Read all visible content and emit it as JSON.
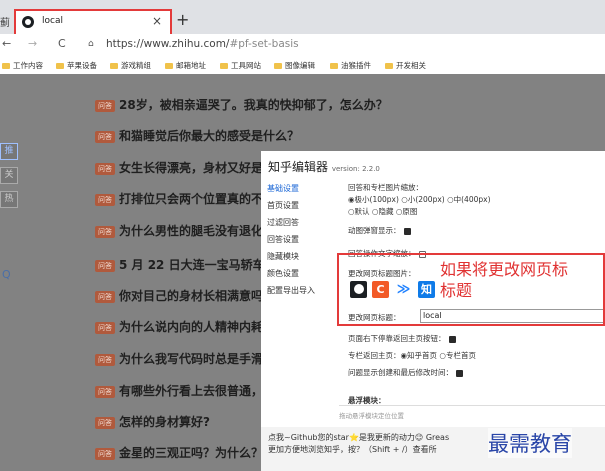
{
  "browser": {
    "left_cut_text": "蓟",
    "tab_title": "local",
    "tab_close": "×",
    "new_tab": "+",
    "back": "←",
    "forward": "→",
    "reload": "C",
    "url_host": "https://www.zhihu.com/",
    "url_rest": "#pf-set-basis",
    "bookmarks": [
      "工作内容",
      "苹果设备",
      "游戏精组",
      "邮箱地址",
      "工具网站",
      "图像编辑",
      "油猴插件",
      "开发相关"
    ]
  },
  "left_sidebar": {
    "tabs": [
      "推",
      "关",
      "热"
    ],
    "search": "Q"
  },
  "questions": {
    "badge": "问答",
    "items": [
      "28岁，被相亲逼哭了。我真的快抑郁了，怎么办？",
      "和猫睡觉后你最大的感受是什么？",
      "女生长得漂亮，身材又好是怎",
      "打排位只会两个位置真的不该",
      "为什么男性的腿毛没有退化掉",
      "5 月 22 日大连一宝马轿车撞",
      "你对目己的身材长相满意吗？",
      "为什么说内向的人精神内耗很",
      "为什么我写代码时总是手滑打",
      "有哪些外行看上去很普通，但",
      "怎样的身材算好?",
      "金星的三观正吗？为什么？"
    ]
  },
  "editor": {
    "title": "知乎编辑器",
    "version": "version: 2.2.0",
    "nav": [
      "基础设置",
      "首页设置",
      "过滤回答",
      "回答设置",
      "隐藏模块",
      "颜色设置",
      "配置导出导入"
    ],
    "img_size_label": "回答和专栏图片缩放：",
    "img_opts_row1": "◉极小(100px)  ○小(200px)  ○中(400px)",
    "img_opts_row2": "○默认  ○隐藏  ○原图",
    "anim_label": "动图弹窗显示：",
    "hover_label": "回答操作文字缩放：",
    "favicon_label": "更改网页标题图片：",
    "favicon_icons": [
      "github-logo",
      "csdn-logo",
      "juejin-logo",
      "zhihu-logo"
    ],
    "icon_c": "C",
    "icon_zhi": "知",
    "icon_juejin": "≫",
    "title_label": "更改网页标题：",
    "title_value": "local",
    "back_top_label": "页面右下停靠返回主页按钮：",
    "column_back_label": "专栏返回主页：",
    "column_back_opts": "◉知乎首页  ○专栏首页",
    "time_label": "问题显示创建和最后修改时间：",
    "float_label": "悬浮模块：",
    "float_sub": "拖动悬浮模块定位位置",
    "footer1": "点我~Github您的star⭐是我更新的动力😉 Greas",
    "footer2": "更加方便地浏览知乎，按？（Shift + /）查看所"
  },
  "annotation": {
    "line1": "如果将更改网页标",
    "line2": "标题"
  },
  "watermark": "最需教育",
  "colors": {
    "accent_red": "#e33a3a",
    "badge": "#b05a3d",
    "watermark": "#2a46a8"
  }
}
